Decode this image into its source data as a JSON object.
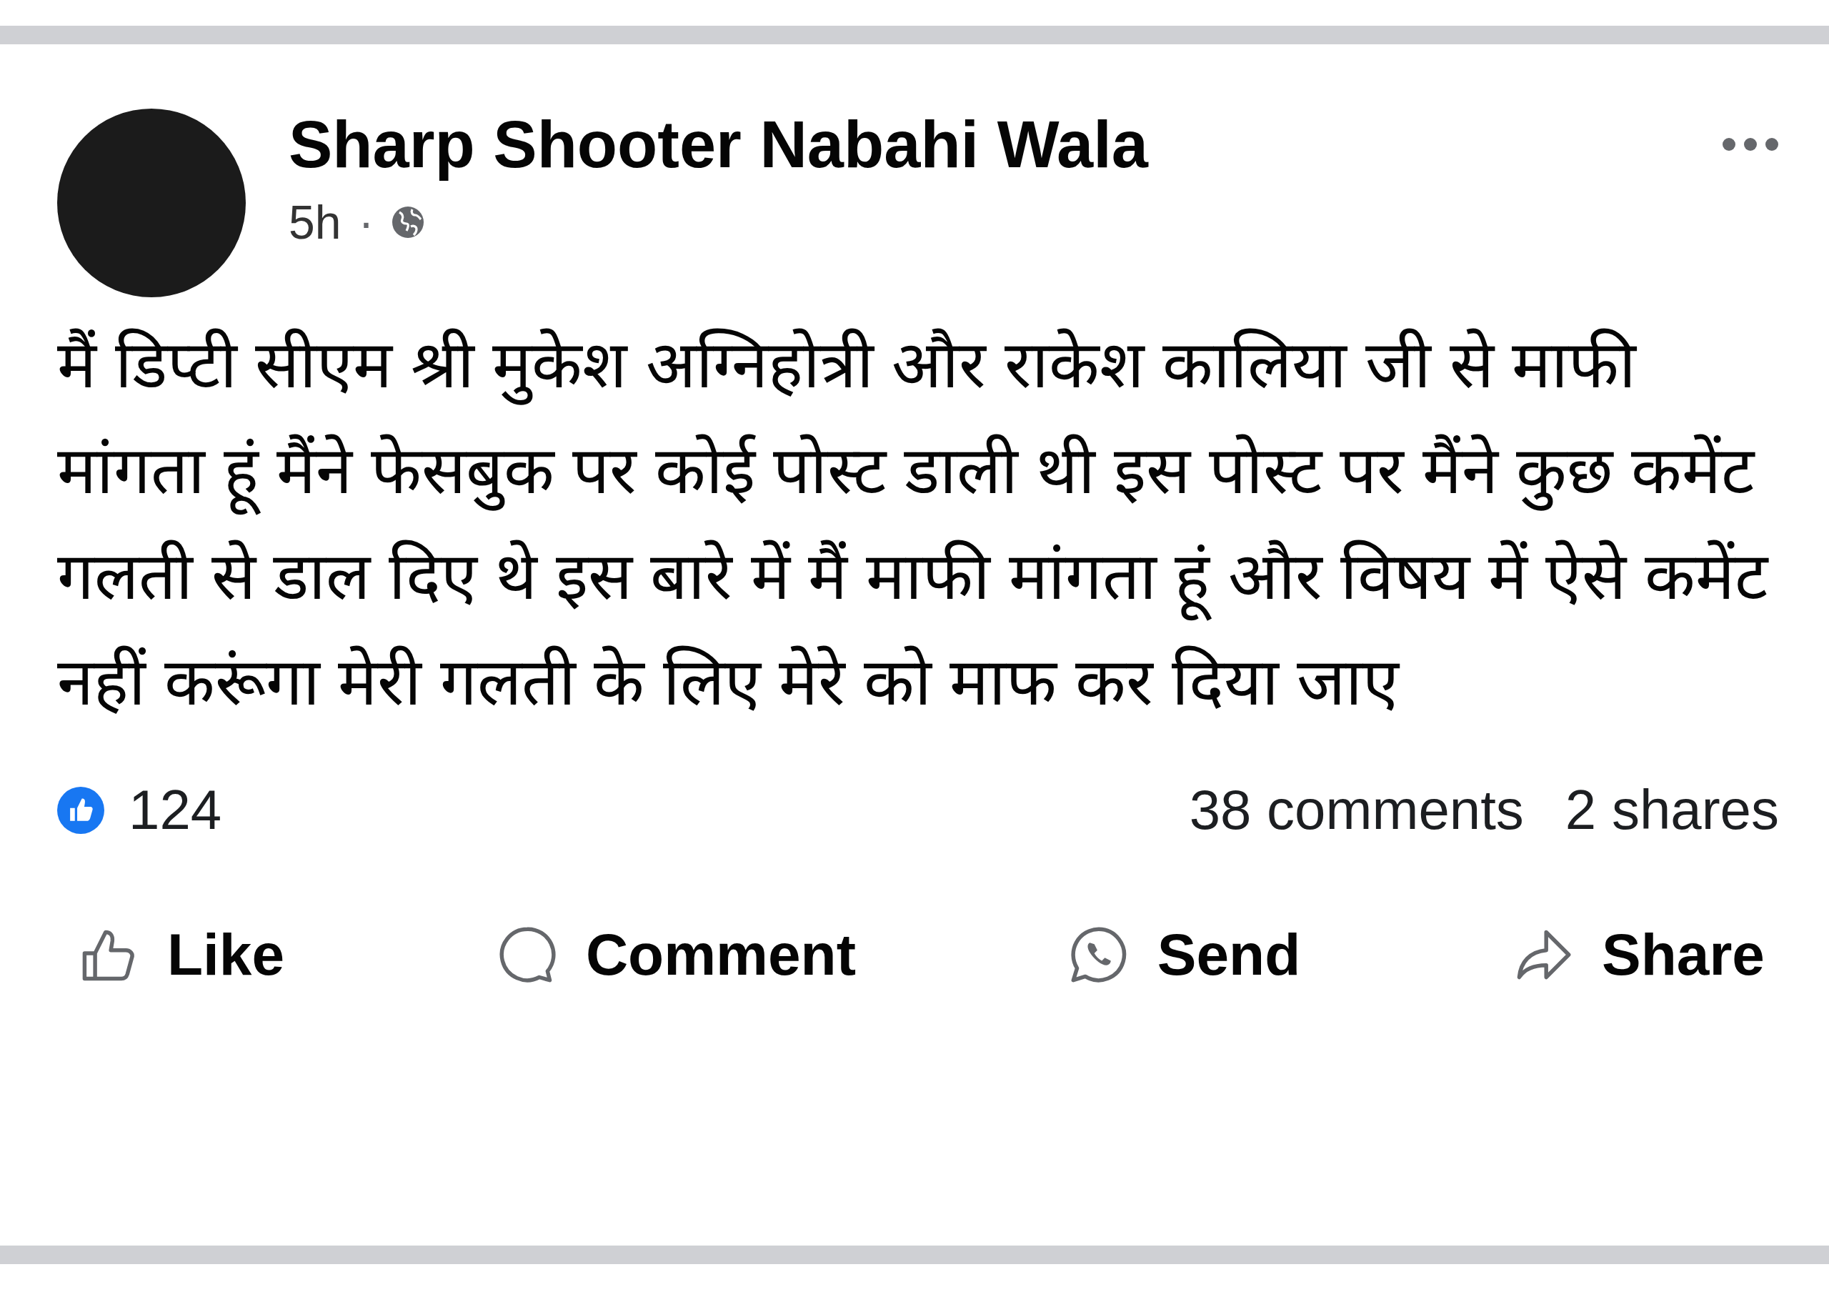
{
  "post": {
    "author": "Sharp Shooter Nabahi Wala",
    "time": "5h",
    "separator": "·",
    "text": "मैं डिप्टी सीएम श्री मुकेश अग्निहोत्री और राकेश कालिया जी से माफी मांगता हूं मैंने फेसबुक पर कोई पोस्ट डाली थी इस पोस्ट पर मैंने कुछ कमेंट गलती से डाल दिए थे इस बारे में मैं माफी मांगता हूं और विषय में ऐसे कमेंट नहीं करूंगा मेरी गलती के लिए मेरे को माफ कर दिया जाए",
    "reactions": "124",
    "comments": "38 comments",
    "shares": "2 shares"
  },
  "actions": [
    {
      "kind": "like",
      "label": "Like"
    },
    {
      "kind": "comment",
      "label": "Comment"
    },
    {
      "kind": "send",
      "label": "Send"
    },
    {
      "kind": "share",
      "label": "Share"
    }
  ]
}
